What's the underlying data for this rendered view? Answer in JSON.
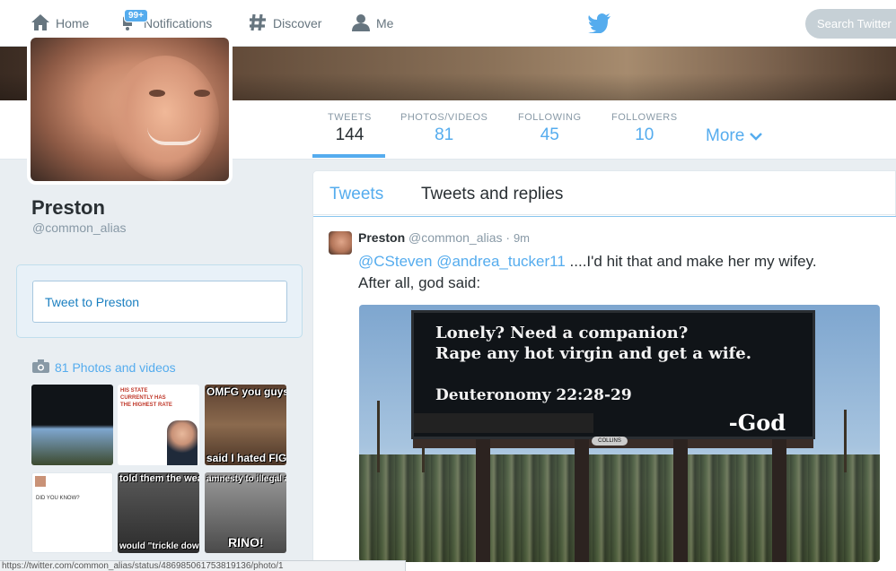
{
  "nav": {
    "home": "Home",
    "notifications": "Notifications",
    "notifications_badge": "99+",
    "discover": "Discover",
    "me": "Me",
    "search_placeholder": "Search Twitter"
  },
  "profile": {
    "name": "Preston",
    "handle": "@common_alias",
    "tweet_to": "Tweet to Preston",
    "photos_link": "81 Photos and videos"
  },
  "stats": [
    {
      "label": "TWEETS",
      "value": "144"
    },
    {
      "label": "PHOTOS/VIDEOS",
      "value": "81"
    },
    {
      "label": "FOLLOWING",
      "value": "45"
    },
    {
      "label": "FOLLOWERS",
      "value": "10"
    }
  ],
  "more_label": "More",
  "tabs": {
    "tweets": "Tweets",
    "replies": "Tweets and replies"
  },
  "tweet": {
    "name": "Preston",
    "handle": "@common_alias",
    "sep": "·",
    "time": "9m",
    "mention1": "@CSteven",
    "mention2": "@andrea_tucker11",
    "text1": "....I'd hit that and make her my wifey.",
    "text2": "After all, god said:",
    "billboard": {
      "line1": "Lonely? Need a companion?",
      "line2": "Rape any hot virgin and get a wife.",
      "line3": "Deuteronomy 22:28-29",
      "sig": "-God",
      "logo": "COLLINS"
    }
  },
  "thumbs": [
    {
      "caption": ""
    },
    {
      "caption": "HIS STATE CURRENTLY HAS THE HIGHEST RATE"
    },
    {
      "caption": "OMFG you guys."
    },
    {
      "caption": "DID YOU KNOW?"
    },
    {
      "caption": "told them the wealt"
    },
    {
      "caption": "amnesty to illegal a"
    }
  ],
  "thumb_extra": {
    "t3_bottom": "said I hated FIG",
    "t5_bottom": "would \"trickle down",
    "t6_bottom": "RINO!"
  },
  "statusbar": "https://twitter.com/common_alias/status/486985061753819136/photo/1"
}
